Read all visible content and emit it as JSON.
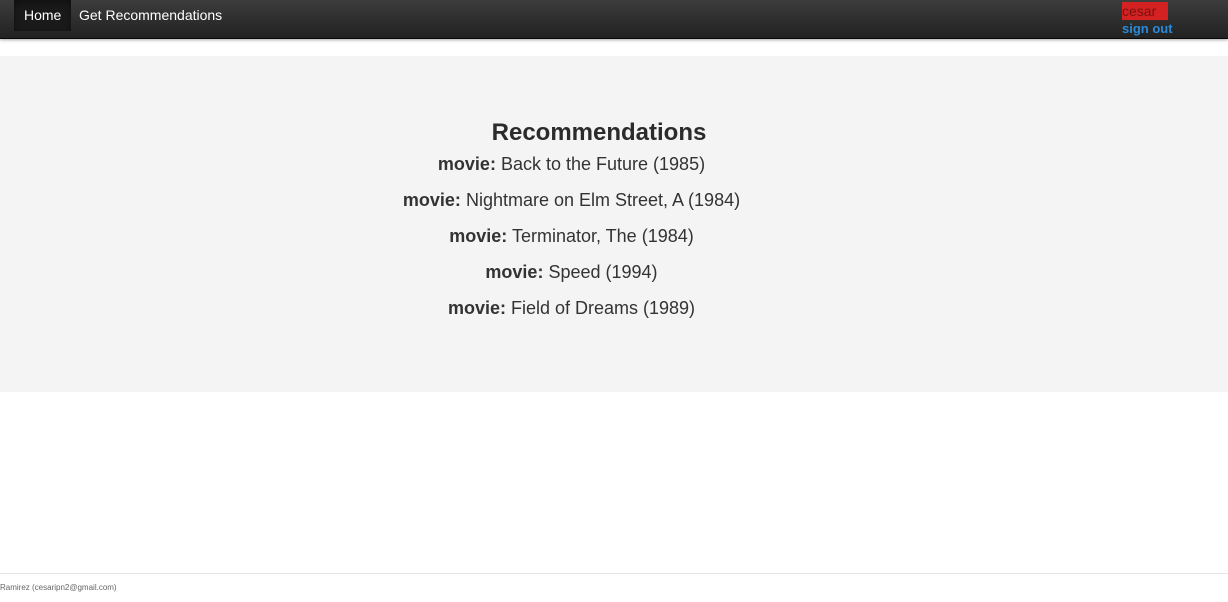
{
  "navbar": {
    "home_label": "Home",
    "recommendations_label": "Get Recommendations",
    "user_name": "cesar",
    "sign_out_label": "sign out"
  },
  "main": {
    "title": "Recommendations",
    "recommendations": [
      {
        "key": "movie:",
        "value": "Back to the Future (1985)"
      },
      {
        "key": "movie:",
        "value": "Nightmare on Elm Street, A (1984)"
      },
      {
        "key": "movie:",
        "value": "Terminator, The (1984)"
      },
      {
        "key": "movie:",
        "value": "Speed (1994)"
      },
      {
        "key": "movie:",
        "value": "Field of Dreams (1989)"
      }
    ]
  },
  "footer": {
    "text": "Ramirez (cesaripn2@gmail.com)"
  },
  "colors": {
    "navbar": "#222222",
    "user_badge": "#d42222",
    "link": "#2a8ad8",
    "jumbotron": "#f4f4f4"
  }
}
